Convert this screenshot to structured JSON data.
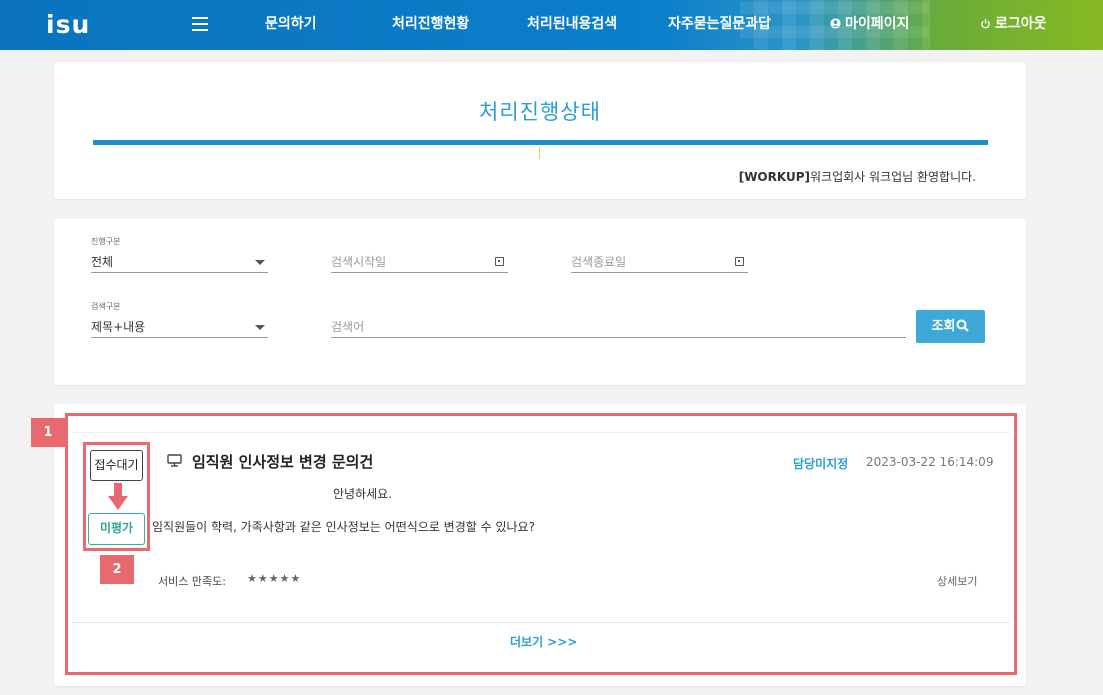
{
  "nav": {
    "logo": "isu",
    "items": [
      "문의하기",
      "처리진행현황",
      "처리된내용검색",
      "자주묻는질문과답"
    ],
    "mypage": "마이페이지",
    "logout": "로그아웃"
  },
  "header": {
    "title": "처리진행상태",
    "welcome_bold": "[WORKUP]",
    "welcome_rest": "워크업회사 워크업님 환영합니다."
  },
  "filters": {
    "progress_label": "진행구분",
    "progress_value": "전체",
    "start_date_placeholder": "검색시작일",
    "end_date_placeholder": "검색종료일",
    "search_type_label": "검색구분",
    "search_type_value": "제목+내용",
    "keyword_placeholder": "검색어",
    "search_button": "조회"
  },
  "annotations": {
    "badge1": "1",
    "badge2": "2"
  },
  "item": {
    "status_before": "접수대기",
    "status_after": "미평가",
    "title": "임직원 인사정보 변경 문의건",
    "assignee": "담당미지정",
    "datetime": "2023-03-22 16:14:09",
    "body_line1": "안녕하세요.",
    "body_line2": "임직원들이 학력, 가족사항과 같은 인사정보는 어떤식으로 변경할 수 있나요?",
    "rating_label": "서비스 만족도:",
    "stars": "★★★★★",
    "detail": "상세보기"
  },
  "more": "더보기 >>>",
  "colors": {
    "nav_blue": "#0b7fca",
    "nav_green": "#86b922",
    "accent": "#2a9fd3",
    "annotation_red": "#e86a6e",
    "eval_teal": "#30a594"
  }
}
